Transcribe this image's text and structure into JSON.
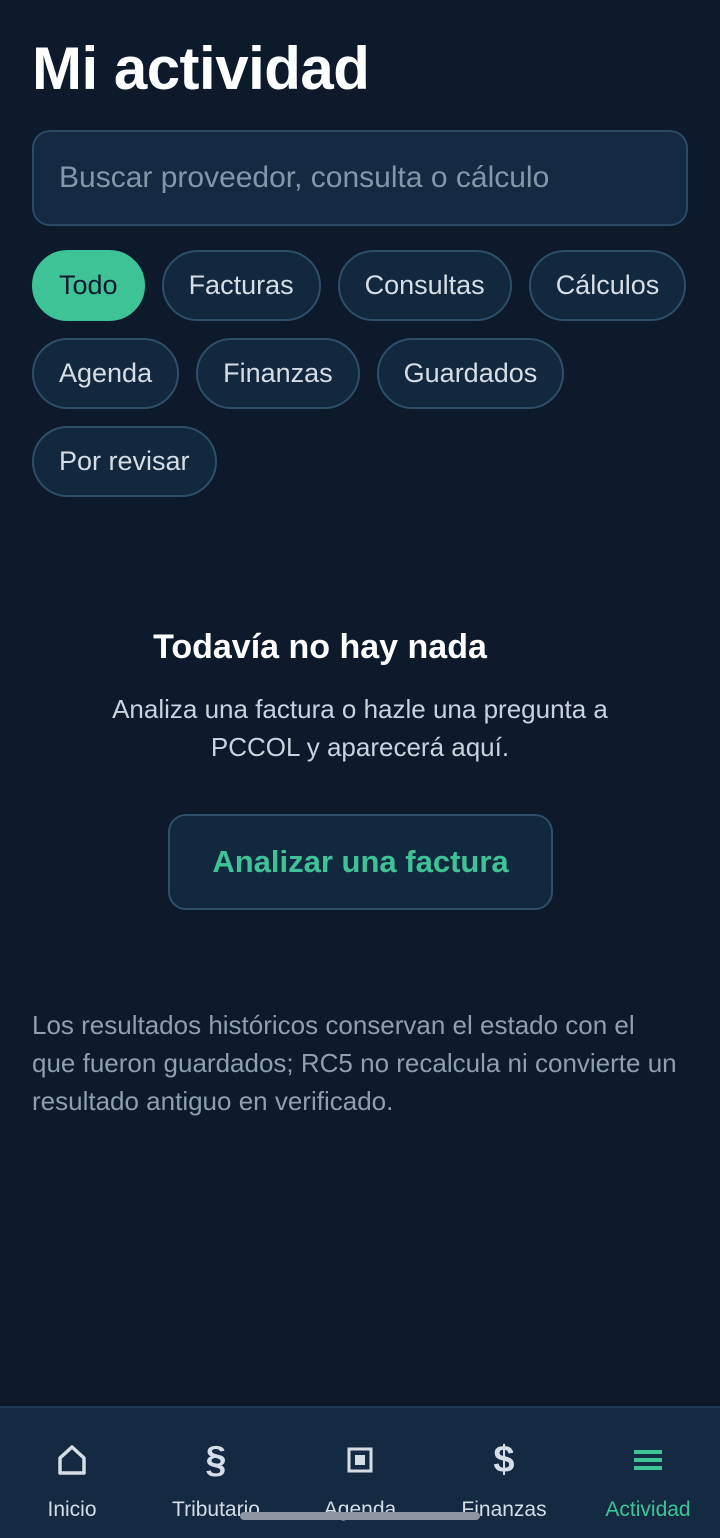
{
  "header": {
    "title": "Mi actividad"
  },
  "search": {
    "placeholder": "Buscar proveedor, consulta o cálculo"
  },
  "filters": [
    {
      "label": "Todo",
      "active": true
    },
    {
      "label": "Facturas",
      "active": false
    },
    {
      "label": "Consultas",
      "active": false
    },
    {
      "label": "Cálculos",
      "active": false
    },
    {
      "label": "Agenda",
      "active": false
    },
    {
      "label": "Finanzas",
      "active": false
    },
    {
      "label": "Guardados",
      "active": false
    },
    {
      "label": "Por revisar",
      "active": false
    }
  ],
  "empty_state": {
    "title": "Todavía no hay nada",
    "description": "Analiza una factura o hazle una pregunta a PCCOL y aparecerá aquí.",
    "cta_label": "Analizar una factura"
  },
  "note": "Los resultados históricos conservan el estado con el que fueron guardados; RC5 no recalcula ni convierte un resultado antiguo en verificado.",
  "nav": {
    "items": [
      {
        "label": "Inicio",
        "icon": "home-icon"
      },
      {
        "label": "Tributario",
        "icon": "section-icon",
        "glyph": "§"
      },
      {
        "label": "Agenda",
        "icon": "square-icon"
      },
      {
        "label": "Finanzas",
        "icon": "dollar-icon",
        "glyph": "$"
      },
      {
        "label": "Actividad",
        "icon": "menu-icon",
        "active": true
      }
    ]
  },
  "colors": {
    "background": "#0c1a2b",
    "accent": "#3ec397",
    "surface": "#132a42"
  }
}
